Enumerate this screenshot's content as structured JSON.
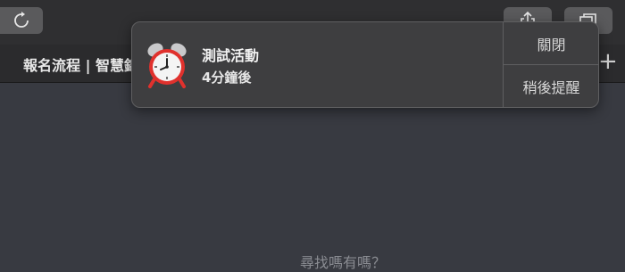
{
  "browser": {
    "bookmarks_bar": {
      "item_label": "報名流程 | 智慧錦",
      "add_symbol": "+"
    },
    "icons": {
      "reload": "reload-icon",
      "share": "share-icon",
      "tabs": "tabs-overview-icon"
    }
  },
  "page": {
    "partial_text": "尋找嗎有嗎？"
  },
  "notification": {
    "icon": "alarm-clock-icon",
    "title": "測試活動",
    "subtitle": "4分鐘後",
    "actions": {
      "close_label": "關閉",
      "snooze_label": "稍後提醒"
    }
  },
  "colors": {
    "background": "#383a41",
    "toolbar": "#2f2f31",
    "notification_bg": "#3e3e40",
    "alarm_red": "#e0312d"
  }
}
